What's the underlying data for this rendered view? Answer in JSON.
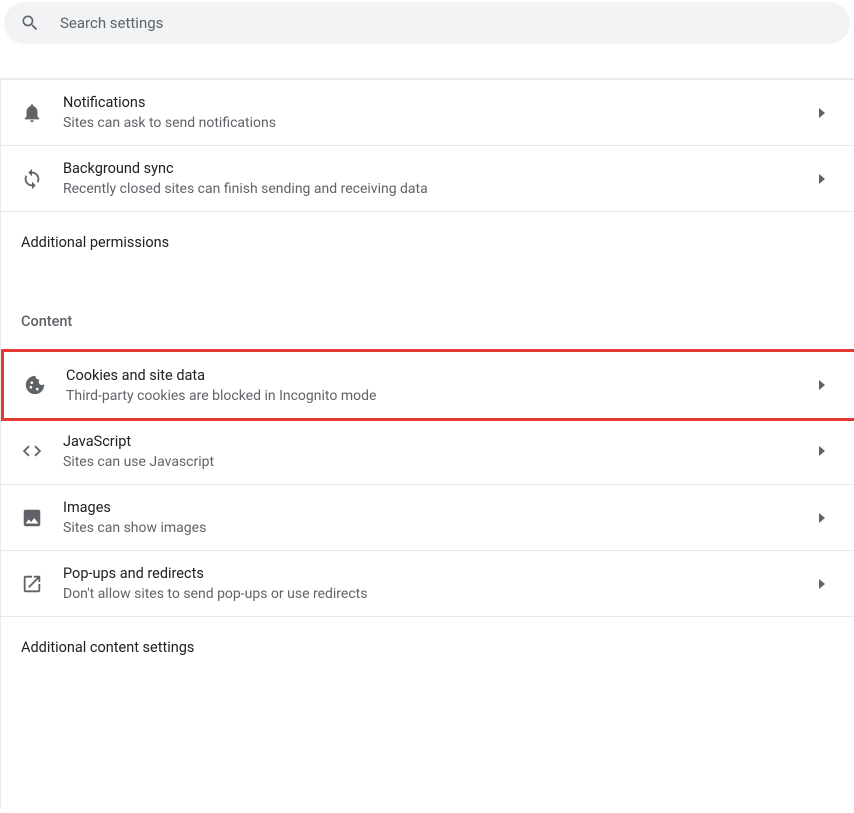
{
  "search": {
    "placeholder": "Search settings"
  },
  "permissions": {
    "notifications": {
      "title": "Notifications",
      "subtitle": "Sites can ask to send notifications"
    },
    "background_sync": {
      "title": "Background sync",
      "subtitle": "Recently closed sites can finish sending and receiving data"
    },
    "additional_permissions_label": "Additional permissions"
  },
  "content": {
    "header": "Content",
    "cookies": {
      "title": "Cookies and site data",
      "subtitle": "Third-party cookies are blocked in Incognito mode"
    },
    "javascript": {
      "title": "JavaScript",
      "subtitle": "Sites can use Javascript"
    },
    "images": {
      "title": "Images",
      "subtitle": "Sites can show images"
    },
    "popups": {
      "title": "Pop-ups and redirects",
      "subtitle": "Don't allow sites to send pop-ups or use redirects"
    },
    "additional_content_label": "Additional content settings"
  }
}
